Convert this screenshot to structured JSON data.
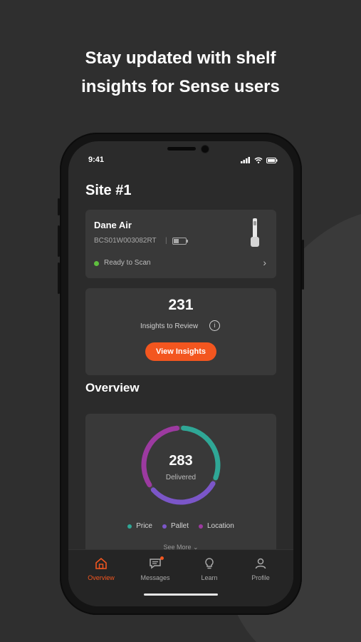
{
  "headline": {
    "line1": "Stay updated with shelf",
    "line2": "insights for Sense users"
  },
  "status_bar": {
    "time": "9:41"
  },
  "site": {
    "title": "Site #1"
  },
  "device": {
    "name": "Dane Air",
    "serial": "BCS01W003082RT",
    "separator": "|",
    "status": "Ready to Scan",
    "status_color": "#5fbf3f",
    "battery_level": 0.45
  },
  "insights": {
    "count": "231",
    "label": "Insights to Review",
    "info_icon": "i",
    "button_label": "View Insights",
    "accent": "#f3561f"
  },
  "overview": {
    "title": "Overview",
    "total": "283",
    "total_label": "Delivered",
    "legend": [
      {
        "label": "Price",
        "color": "#2fa796"
      },
      {
        "label": "Pallet",
        "color": "#7b56c8"
      },
      {
        "label": "Location",
        "color": "#9c3aa0"
      }
    ],
    "see_more": "See More"
  },
  "tabs": [
    {
      "label": "Overview",
      "icon": "home-icon",
      "active": true
    },
    {
      "label": "Messages",
      "icon": "messages-icon",
      "active": false
    },
    {
      "label": "Learn",
      "icon": "lightbulb-icon",
      "active": false
    },
    {
      "label": "Profile",
      "icon": "profile-icon",
      "active": false
    }
  ]
}
